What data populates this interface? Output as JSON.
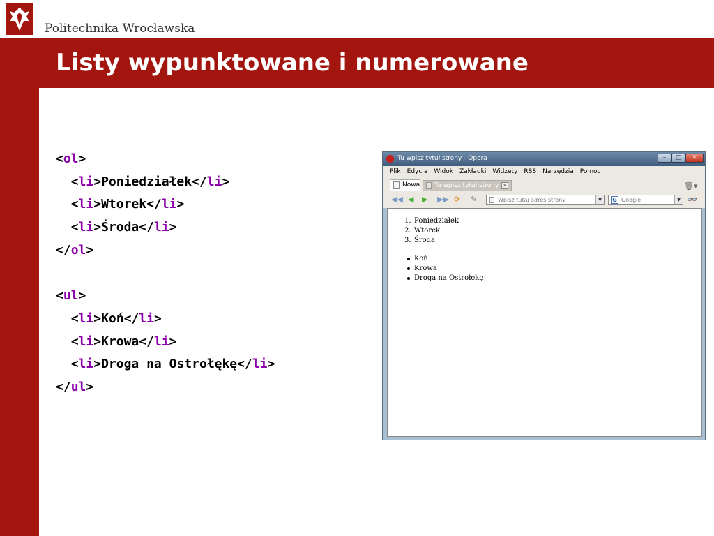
{
  "slide": {
    "university": "Politechnika Wrocławska",
    "title": "Listy wypunktowane i numerowane"
  },
  "code": {
    "ol_open": {
      "lt": "<",
      "tag": "ol",
      "gt": ">"
    },
    "ol_items": [
      {
        "text": "Poniedziałek"
      },
      {
        "text": "Wtorek"
      },
      {
        "text": "Środa"
      }
    ],
    "ol_close": {
      "lt": "</",
      "tag": "ol",
      "gt": ">"
    },
    "ul_open": {
      "lt": "<",
      "tag": "ul",
      "gt": ">"
    },
    "ul_items": [
      {
        "text": "Koń"
      },
      {
        "text": "Krowa"
      },
      {
        "text": "Droga na Ostrołękę"
      }
    ],
    "ul_close": {
      "lt": "</",
      "tag": "ul",
      "gt": ">"
    },
    "li_open_lt": "<",
    "li_tag": "li",
    "li_open_gt": ">",
    "li_close_lt": "</",
    "li_close_gt": ">"
  },
  "browser": {
    "window_title": "Tu wpisz tytuł strony - Opera",
    "menu": [
      "Plik",
      "Edycja",
      "Widok",
      "Zakładki",
      "Widżety",
      "RSS",
      "Narzędzia",
      "Pomoc"
    ],
    "tabs": [
      {
        "label": "Nowa"
      },
      {
        "label": "Tu wpisz tytuł strony"
      }
    ],
    "address_placeholder": "Wpisz tutaj adres strony",
    "search_placeholder": "Google",
    "ordered_list": [
      "Poniedziałek",
      "Wtorek",
      "Środa"
    ],
    "ordered_markers": [
      "1.",
      "2.",
      "3."
    ],
    "unordered_list": [
      "Koń",
      "Krowa",
      "Droga na Ostrołękę"
    ],
    "icons": [
      "opera-icon",
      "minimize-icon",
      "maximize-icon",
      "close-icon",
      "page-icon",
      "trash-icon",
      "rewind-icon",
      "back-icon",
      "forward-icon",
      "fast-forward-icon",
      "reload-icon",
      "edit-icon",
      "google-icon",
      "glasses-icon"
    ]
  },
  "colors": {
    "brand_red": "#a3150f",
    "tag_purple": "#8b00a8"
  }
}
